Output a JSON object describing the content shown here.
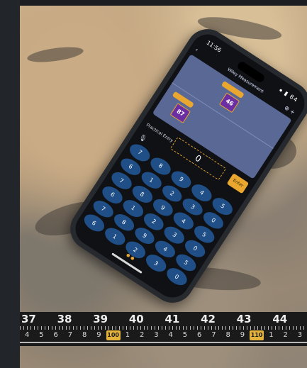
{
  "phone": {
    "status_time": "11:56",
    "status_right": "⦁ ▮ 84",
    "nav_title": "Wiley Measurement",
    "entry_label": "Practical Entry",
    "entry_value": "0",
    "enter_label": "Enter",
    "chip_top": "46",
    "chip_left": "87",
    "keys": [
      "7",
      "8",
      "9",
      "4",
      "5",
      "6",
      "1",
      "2",
      "3",
      "0",
      "7",
      "8",
      "9",
      "4",
      "5",
      "6",
      "1",
      "2",
      "3",
      "0",
      "7",
      "8",
      "9",
      "4",
      "5",
      "6",
      "1",
      "2",
      "3",
      "0"
    ]
  },
  "ruler": {
    "top_numbers": [
      "37",
      "38",
      "39",
      "40",
      "41",
      "42",
      "43",
      "44"
    ],
    "bottom_numbers": [
      "4",
      "5",
      "6",
      "7",
      "8",
      "9",
      "100",
      "1",
      "2",
      "3",
      "4",
      "5",
      "6",
      "7",
      "8",
      "9",
      "110",
      "1",
      "2",
      "3"
    ]
  },
  "colors": {
    "accent": "#e9a72f",
    "key_blue": "#1f4f86",
    "chip_purple": "#6b2fa3"
  }
}
